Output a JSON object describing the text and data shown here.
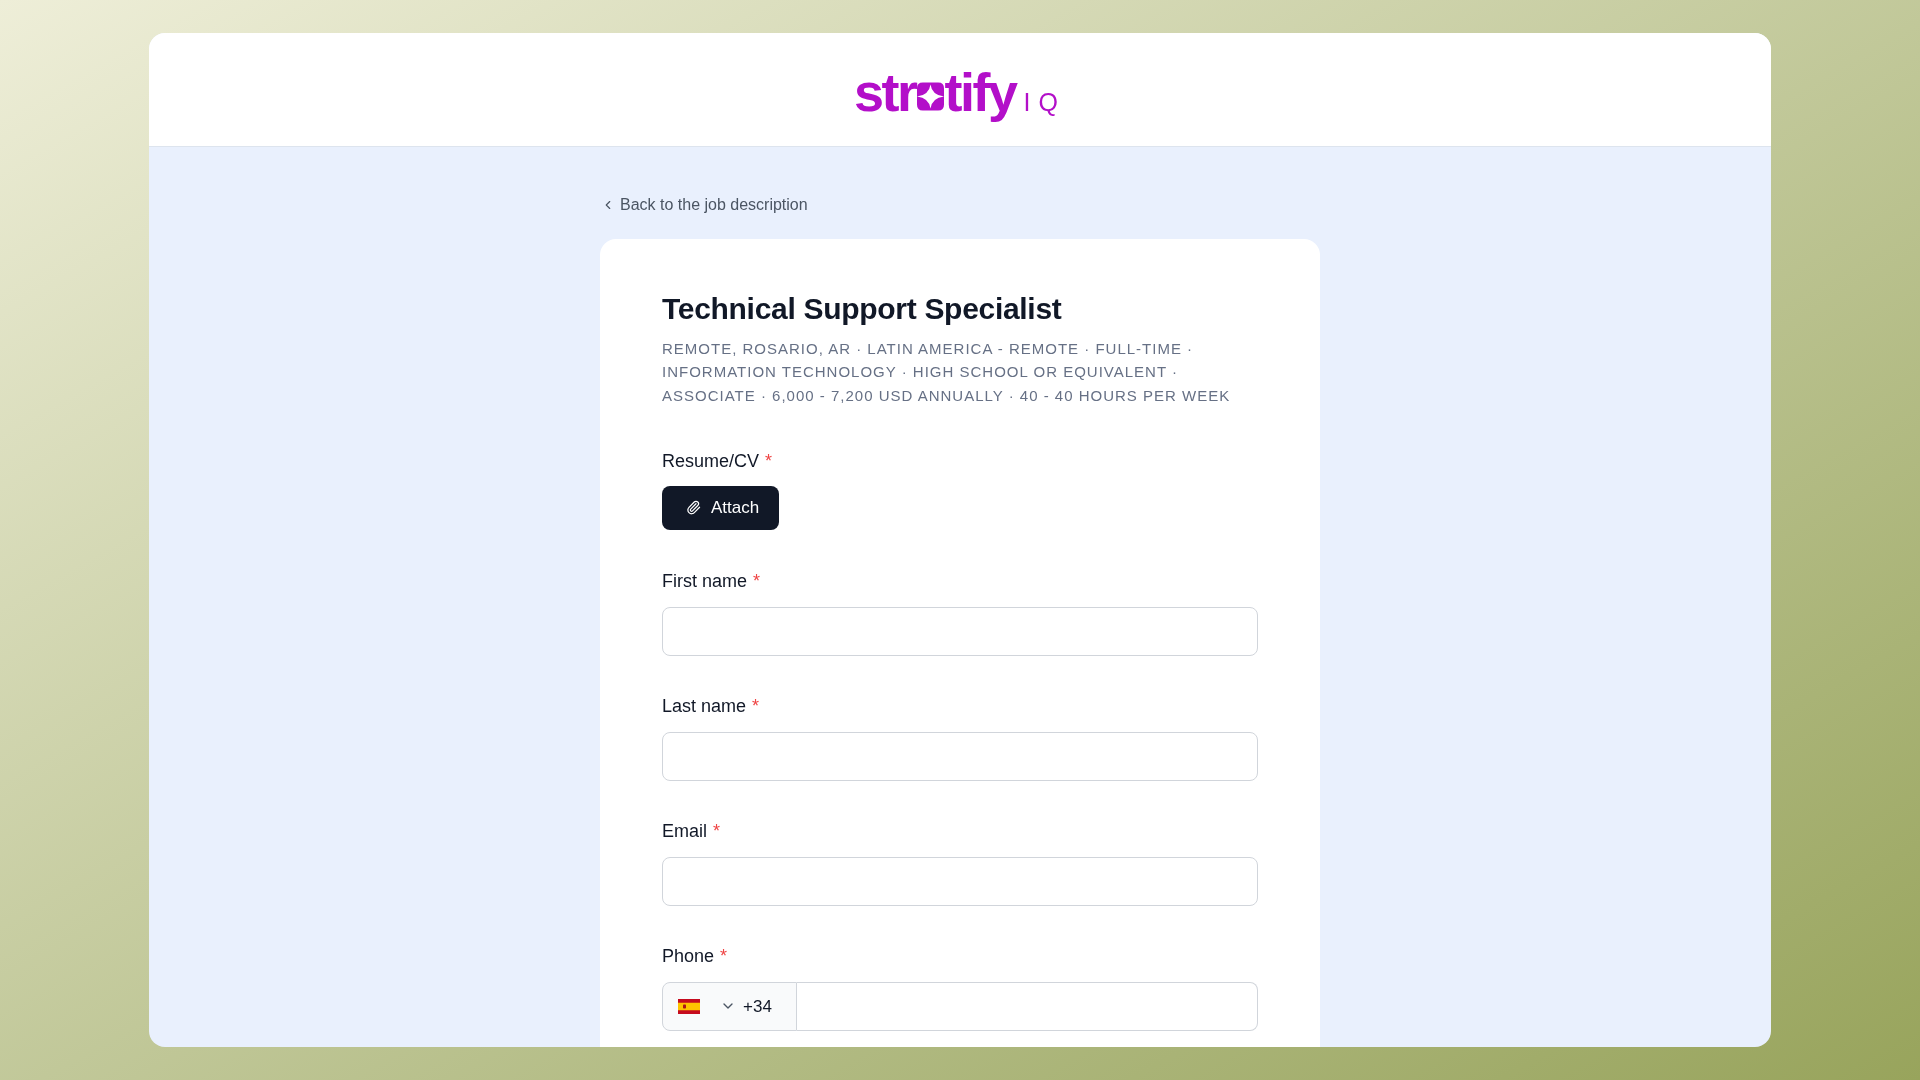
{
  "header": {
    "logo": {
      "wordmark_start": "str",
      "wordmark_end": "tify",
      "suffix": "IQ"
    }
  },
  "back_link": {
    "label": "Back to the job description"
  },
  "job": {
    "title": "Technical Support Specialist",
    "meta": "REMOTE, ROSARIO, AR · LATIN AMERICA - REMOTE · FULL-TIME · INFORMATION TECHNOLOGY · HIGH SCHOOL OR EQUIVALENT · ASSOCIATE · 6,000 - 7,200 USD ANNUALLY · 40 - 40 HOURS PER WEEK"
  },
  "form": {
    "fields": [
      {
        "kind": "file",
        "label": "Resume/CV",
        "required_mark": "*",
        "button": "Attach"
      },
      {
        "kind": "text",
        "label": "First name",
        "required_mark": "*"
      },
      {
        "kind": "text",
        "label": "Last name",
        "required_mark": "*"
      },
      {
        "kind": "text",
        "label": "Email",
        "required_mark": "*"
      },
      {
        "kind": "phone",
        "label": "Phone",
        "required_mark": "*",
        "country_code": "+34"
      }
    ]
  }
}
